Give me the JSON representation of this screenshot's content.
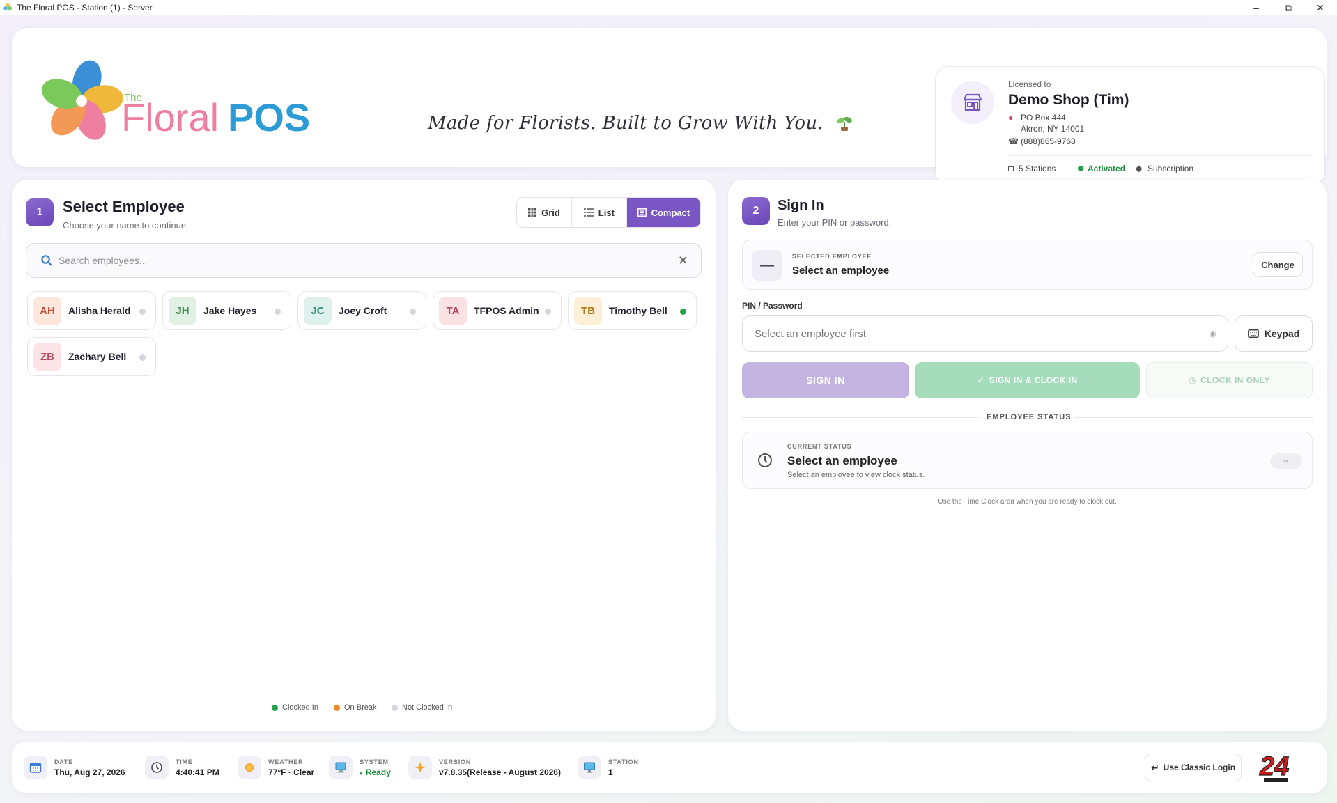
{
  "window": {
    "title": "The Floral POS - Station (1) - Server"
  },
  "header": {
    "logo_prefix": "The",
    "logo_floral": "Floral",
    "logo_pos": "POS",
    "tagline": "Made for Florists. Built to Grow With You.",
    "license": {
      "licensed_to_label": "Licensed to",
      "shop_name": "Demo Shop (Tim)",
      "address_line1": "PO Box 444",
      "address_line2": "Akron, NY 14001",
      "phone": "(888)865-9768",
      "stations": "5 Stations",
      "status": "Activated",
      "subscription": "Subscription"
    }
  },
  "select_panel": {
    "step": "1",
    "title": "Select Employee",
    "subtitle": "Choose your name to continue.",
    "view_modes": [
      "Grid",
      "List",
      "Compact"
    ],
    "active_view": "Compact",
    "search_placeholder": "Search employees...",
    "employees": [
      {
        "initials": "AH",
        "name": "Alisha Herald",
        "status": "not_clocked_in"
      },
      {
        "initials": "JH",
        "name": "Jake Hayes",
        "status": "not_clocked_in"
      },
      {
        "initials": "JC",
        "name": "Joey Croft",
        "status": "not_clocked_in"
      },
      {
        "initials": "TA",
        "name": "TFPOS Admin",
        "status": "not_clocked_in"
      },
      {
        "initials": "TB",
        "name": "Timothy Bell",
        "status": "clocked_in"
      },
      {
        "initials": "ZB",
        "name": "Zachary Bell",
        "status": "not_clocked_in"
      }
    ],
    "legend": {
      "clocked_in": "Clocked In",
      "on_break": "On Break",
      "not_clocked_in": "Not Clocked In"
    }
  },
  "sign_panel": {
    "step": "2",
    "title": "Sign In",
    "subtitle": "Enter your PIN or password.",
    "selected_caption": "SELECTED EMPLOYEE",
    "selected_value": "Select an employee",
    "selected_placeholder_glyph": "—",
    "change_button": "Change",
    "pin_label": "PIN / Password",
    "pin_placeholder": "Select an employee first",
    "keypad_button": "Keypad",
    "sign_in_button": "SIGN IN",
    "sign_in_clock_button": "SIGN IN & CLOCK IN",
    "clock_only_button": "CLOCK IN ONLY",
    "employee_status_label": "EMPLOYEE STATUS",
    "current_status_caption": "CURRENT STATUS",
    "current_status_value": "Select an employee",
    "current_status_sub": "Select an employee to view clock status.",
    "status_pill": "--",
    "note": "Use the Time Clock area when you are ready to clock out."
  },
  "footer": {
    "date_label": "DATE",
    "date_value": "Thu, Aug 27, 2026",
    "time_label": "TIME",
    "time_value": "4:40:41 PM",
    "weather_label": "WEATHER",
    "weather_value": "77°F · Clear",
    "system_label": "SYSTEM",
    "system_value": "Ready",
    "version_label": "VERSION",
    "version_value": "v7.8.35(Release - August 2026)",
    "station_label": "STATION",
    "station_value": "1",
    "classic_login": "Use Classic Login"
  },
  "colors": {
    "accent": "#7a55c4",
    "clocked_in": "#22a34a",
    "on_break": "#e88a2a",
    "not_clocked_in": "#d6d6de",
    "logo_pos": "#2d9bd6"
  }
}
